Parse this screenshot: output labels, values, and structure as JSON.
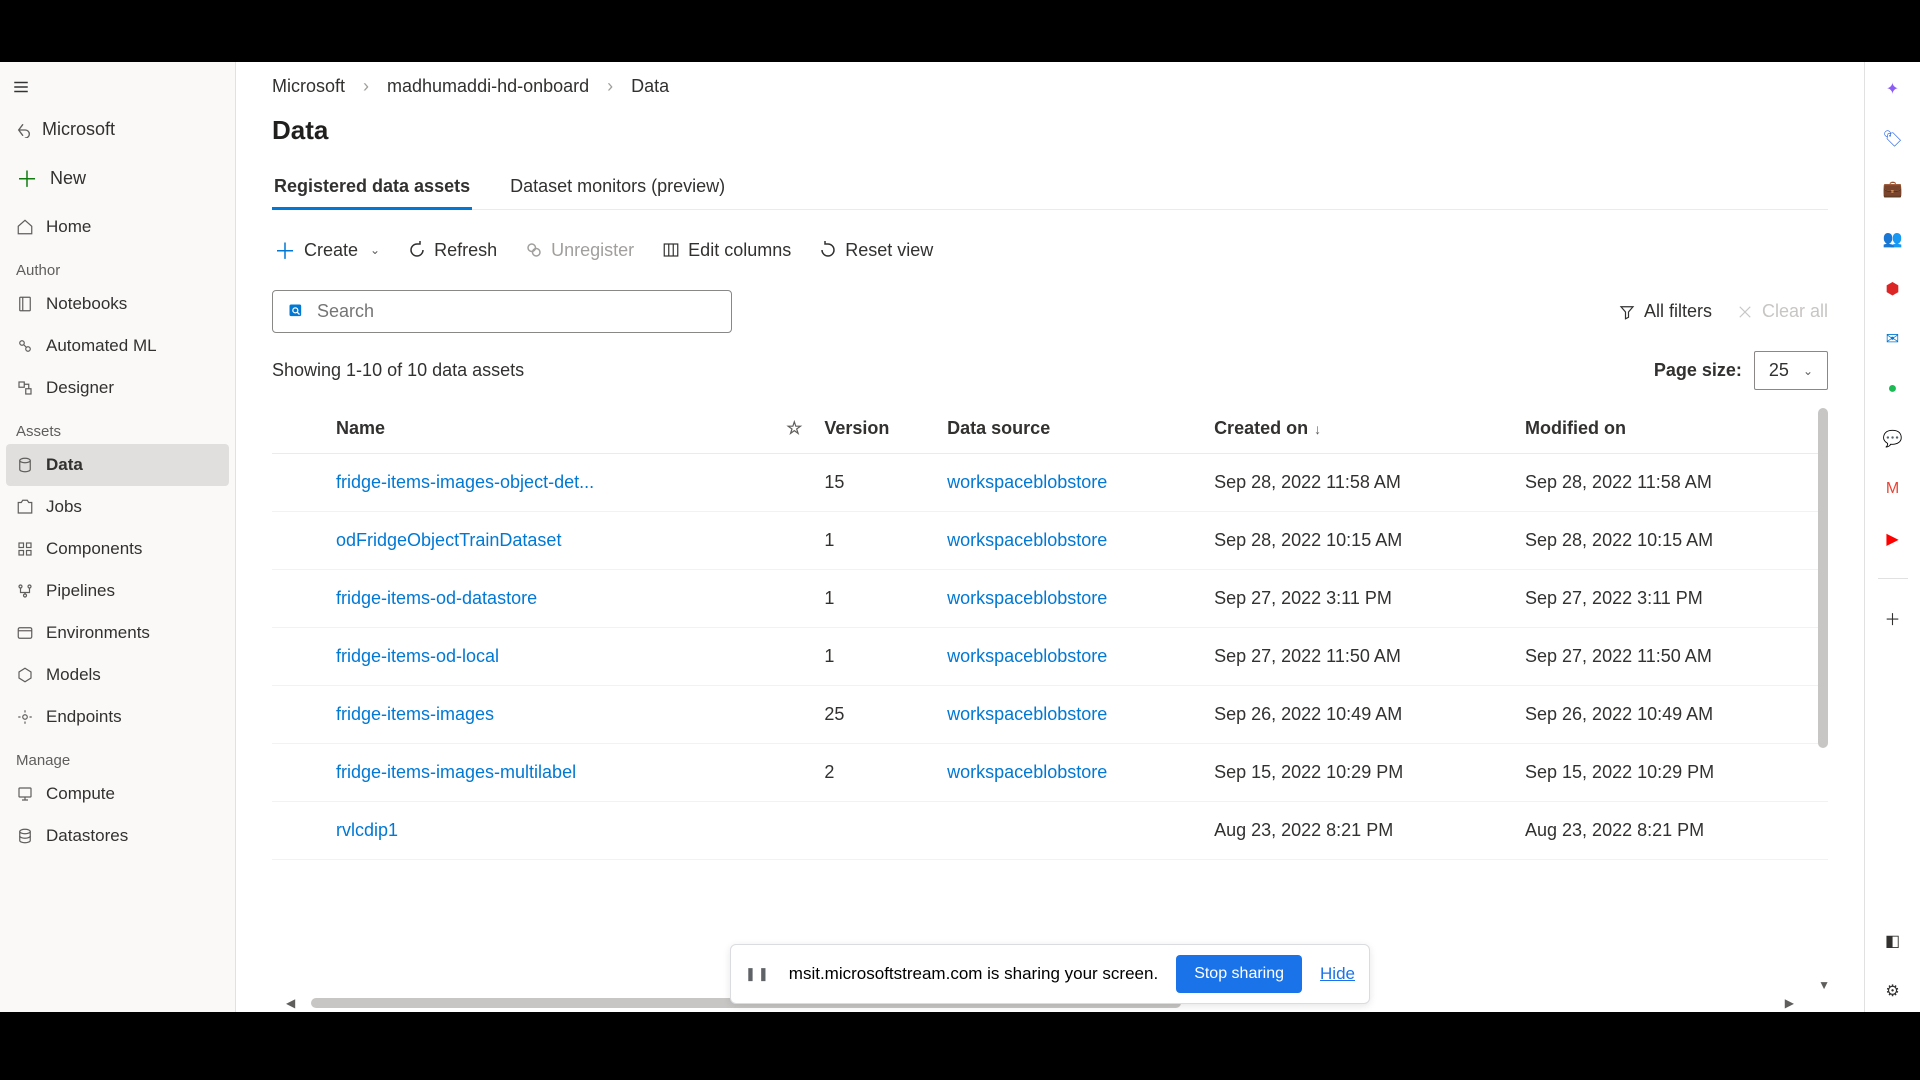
{
  "sidebar": {
    "back_label": "Microsoft",
    "new_label": "New",
    "section_author": "Author",
    "section_assets": "Assets",
    "section_manage": "Manage",
    "items": {
      "home": "Home",
      "notebooks": "Notebooks",
      "automl": "Automated ML",
      "designer": "Designer",
      "data": "Data",
      "jobs": "Jobs",
      "components": "Components",
      "pipelines": "Pipelines",
      "environments": "Environments",
      "models": "Models",
      "endpoints": "Endpoints",
      "compute": "Compute",
      "datastores": "Datastores"
    }
  },
  "breadcrumb": {
    "a": "Microsoft",
    "b": "madhumaddi-hd-onboard",
    "c": "Data"
  },
  "page": {
    "title": "Data"
  },
  "tabs": {
    "a": "Registered data assets",
    "b": "Dataset monitors (preview)"
  },
  "toolbar": {
    "create": "Create",
    "refresh": "Refresh",
    "unregister": "Unregister",
    "edit": "Edit columns",
    "reset": "Reset view"
  },
  "search": {
    "placeholder": "Search"
  },
  "filters": {
    "all": "All filters",
    "clear": "Clear all"
  },
  "status": {
    "showing": "Showing 1-10 of 10 data assets",
    "page_size_label": "Page size:",
    "page_size_value": "25"
  },
  "columns": {
    "name": "Name",
    "version": "Version",
    "source": "Data source",
    "created": "Created on",
    "modified": "Modified on"
  },
  "rows": [
    {
      "name": "fridge-items-images-object-det...",
      "version": "15",
      "source": "workspaceblobstore",
      "created": "Sep 28, 2022 11:58 AM",
      "modified": "Sep 28, 2022 11:58 AM"
    },
    {
      "name": "odFridgeObjectTrainDataset",
      "version": "1",
      "source": "workspaceblobstore",
      "created": "Sep 28, 2022 10:15 AM",
      "modified": "Sep 28, 2022 10:15 AM"
    },
    {
      "name": "fridge-items-od-datastore",
      "version": "1",
      "source": "workspaceblobstore",
      "created": "Sep 27, 2022 3:11 PM",
      "modified": "Sep 27, 2022 3:11 PM"
    },
    {
      "name": "fridge-items-od-local",
      "version": "1",
      "source": "workspaceblobstore",
      "created": "Sep 27, 2022 11:50 AM",
      "modified": "Sep 27, 2022 11:50 AM"
    },
    {
      "name": "fridge-items-images",
      "version": "25",
      "source": "workspaceblobstore",
      "created": "Sep 26, 2022 10:49 AM",
      "modified": "Sep 26, 2022 10:49 AM"
    },
    {
      "name": "fridge-items-images-multilabel",
      "version": "2",
      "source": "workspaceblobstore",
      "created": "Sep 15, 2022 10:29 PM",
      "modified": "Sep 15, 2022 10:29 PM"
    },
    {
      "name": "rvlcdip1",
      "version": "",
      "source": "",
      "created": "Aug 23, 2022 8:21 PM",
      "modified": "Aug 23, 2022 8:21 PM"
    }
  ],
  "share": {
    "text": "msit.microsoftstream.com is sharing your screen.",
    "stop": "Stop sharing",
    "hide": "Hide"
  },
  "rail": {
    "icons": [
      "sparkle-icon",
      "tag-icon",
      "briefcase-icon",
      "people-icon",
      "office-icon",
      "outlook-icon",
      "spotify-icon",
      "messenger-icon",
      "gmail-icon",
      "youtube-icon",
      "plus-icon",
      "panel-icon",
      "gear-icon"
    ]
  },
  "colors": {
    "link": "#0078d4",
    "primary": "#1a73e8"
  }
}
